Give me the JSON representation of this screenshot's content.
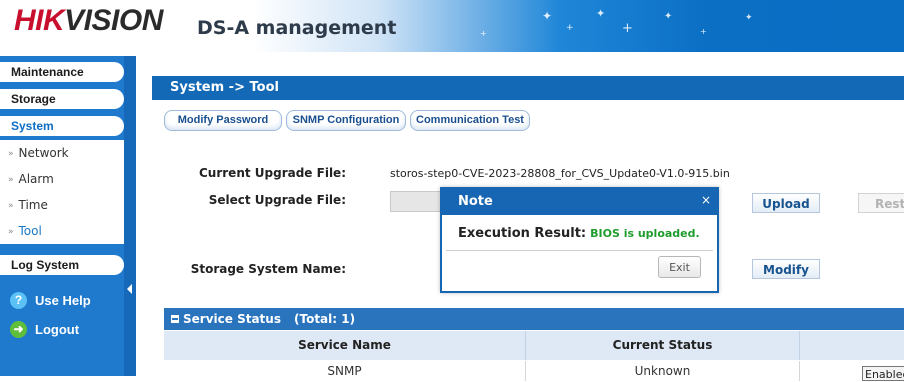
{
  "header": {
    "logo_primary": "HIK",
    "logo_secondary": "VISION",
    "app_title": "DS-A management"
  },
  "sidebar": {
    "categories": {
      "maintenance": "Maintenance",
      "storage": "Storage",
      "system": "System",
      "log_system": "Log System"
    },
    "items": [
      {
        "label": "Network"
      },
      {
        "label": "Alarm"
      },
      {
        "label": "Time"
      },
      {
        "label": "Tool"
      }
    ],
    "help": "Use Help",
    "logout": "Logout"
  },
  "main": {
    "title": "System -> Tool",
    "tabs": [
      "Modify Password",
      "SNMP Configuration",
      "Communication Test"
    ],
    "current_upgrade_file_label": "Current Upgrade File:",
    "current_upgrade_file_value": "storos-step0-CVE-2023-28808_for_CVS_Update0-V1.0-915.bin",
    "select_upgrade_file_label": "Select Upgrade File:",
    "upload_button": "Upload",
    "restore_button": "Resto",
    "storage_system_name_label": "Storage System Name:",
    "modify_button": "Modify"
  },
  "service_status": {
    "title": "Service Status",
    "total": "(Total: 1)",
    "columns": [
      "Service Name",
      "Current Status",
      ""
    ],
    "rows": [
      {
        "service_name": "SNMP",
        "current_status": "Unknown",
        "action": "Enabled"
      }
    ]
  },
  "modal": {
    "title": "Note",
    "close_glyph": "×",
    "result_label": "Execution Result:",
    "result_value": "BIOS is uploaded.",
    "exit_button": "Exit"
  },
  "colors": {
    "brand_red": "#c8102e",
    "primary_blue": "#1469b6",
    "success_green": "#1e9c2c"
  }
}
